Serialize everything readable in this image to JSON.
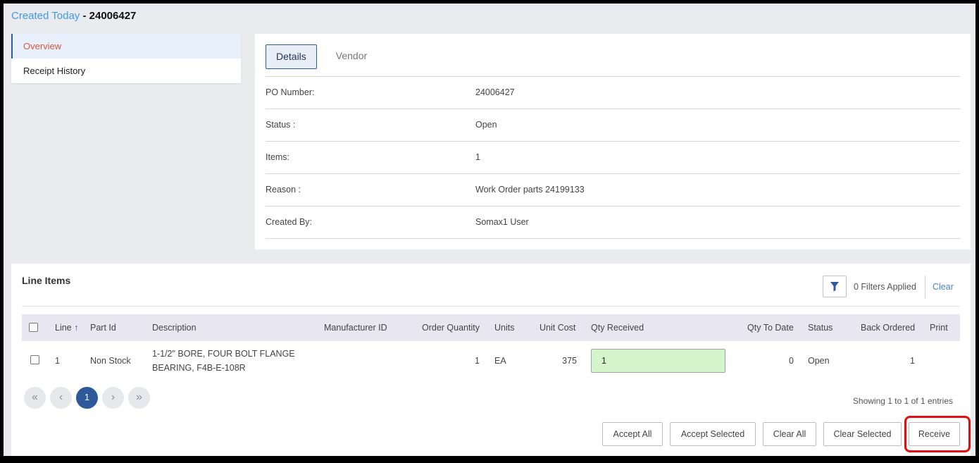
{
  "header": {
    "link": "Created Today",
    "separator": " - ",
    "po_number": "24006427"
  },
  "sidebar": {
    "items": [
      {
        "label": "Overview"
      },
      {
        "label": "Receipt History"
      }
    ]
  },
  "details": {
    "tabs": [
      {
        "label": "Details"
      },
      {
        "label": "Vendor"
      }
    ],
    "fields": [
      {
        "label": "PO Number:",
        "value": "24006427"
      },
      {
        "label": "Status :",
        "value": "Open"
      },
      {
        "label": "Items:",
        "value": "1"
      },
      {
        "label": "Reason :",
        "value": "Work Order parts 24199133"
      },
      {
        "label": "Created By:",
        "value": "Somax1 User"
      }
    ]
  },
  "line_items": {
    "title": "Line Items",
    "filters_applied": "0 Filters Applied",
    "clear_label": "Clear",
    "columns": {
      "line": "Line",
      "part_id": "Part Id",
      "description": "Description",
      "manufacturer_id": "Manufacturer ID",
      "order_quantity": "Order Quantity",
      "units": "Units",
      "unit_cost": "Unit Cost",
      "qty_received": "Qty Received",
      "qty_to_date": "Qty To Date",
      "status": "Status",
      "back_ordered": "Back Ordered",
      "print": "Print"
    },
    "sort_arrow": "↑",
    "rows": [
      {
        "line": "1",
        "part_id": "Non Stock",
        "description_line1": "1-1/2\" BORE, FOUR BOLT FLANGE",
        "description_line2": "BEARING, F4B-E-108R",
        "manufacturer_id": "",
        "order_quantity": "1",
        "units": "EA",
        "unit_cost": "375",
        "qty_received": "1",
        "qty_to_date": "0",
        "status": "Open",
        "back_ordered": "1",
        "print": ""
      }
    ],
    "pagination": {
      "first": "«",
      "prev": "‹",
      "current": "1",
      "next": "›",
      "last": "»"
    },
    "showing": "Showing 1 to 1 of 1 entries",
    "buttons": {
      "accept_all": "Accept All",
      "accept_selected": "Accept Selected",
      "clear_all": "Clear All",
      "clear_selected": "Clear Selected",
      "receive": "Receive"
    }
  },
  "colors": {
    "link": "#3d9be9",
    "active_nav_text": "#e0553c",
    "primary": "#2f5a9a",
    "qty_input_bg": "#d5f6cd",
    "highlight": "#e20d0d"
  }
}
